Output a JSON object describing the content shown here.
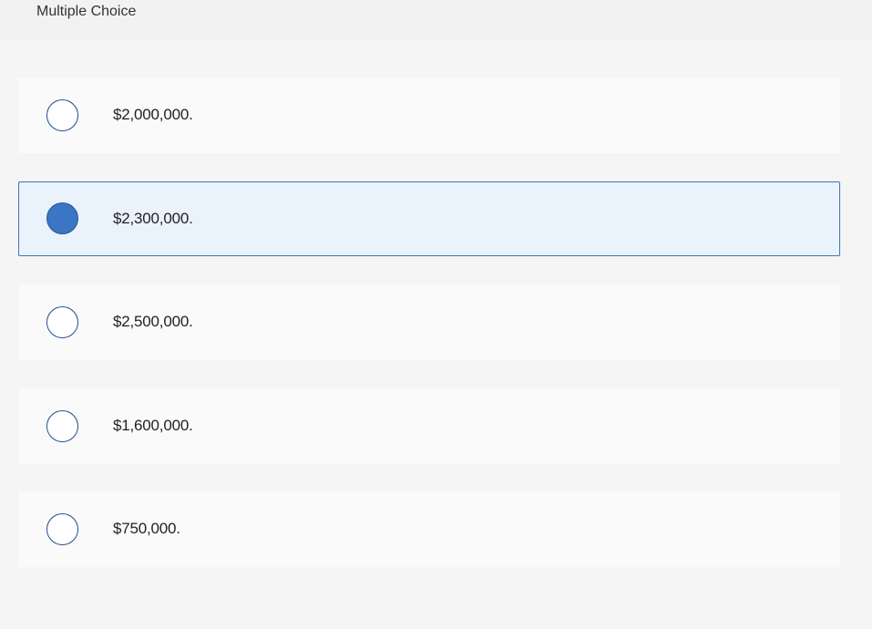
{
  "question": {
    "type_label": "Multiple Choice"
  },
  "choices": [
    {
      "label": "$2,000,000.",
      "selected": false
    },
    {
      "label": "$2,300,000.",
      "selected": true
    },
    {
      "label": "$2,500,000.",
      "selected": false
    },
    {
      "label": "$1,600,000.",
      "selected": false
    },
    {
      "label": "$750,000.",
      "selected": false
    }
  ],
  "colors": {
    "selected_fill": "#3a76c4",
    "selected_background": "#eaf2fc",
    "radio_border": "#1f4e8c"
  }
}
